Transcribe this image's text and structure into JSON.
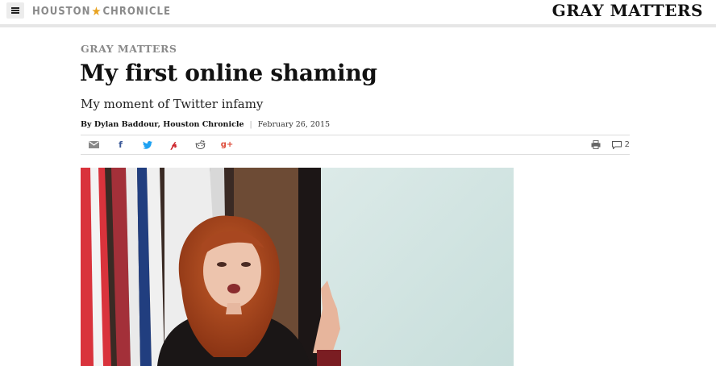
{
  "header": {
    "menu_icon": "hamburger-menu-icon",
    "brand_left": "HOUSTON",
    "brand_right": "CHRONICLE",
    "brand_star_icon": "star-icon",
    "section_brand": "GRAY MATTERS"
  },
  "article": {
    "kicker": "GRAY MATTERS",
    "headline": "My first online shaming",
    "dek": "My moment of Twitter infamy",
    "byline": "By Dylan Baddour, Houston Chronicle",
    "separator": "|",
    "date": "February 26, 2015"
  },
  "share": {
    "icons": [
      "email-icon",
      "facebook-icon",
      "twitter-icon",
      "pinterest-icon",
      "reddit-icon",
      "google-plus-icon"
    ],
    "print_icon": "print-icon",
    "comment_icon": "comment-icon",
    "comment_count": "2"
  },
  "colors": {
    "brand_star": "#e8a21f",
    "facebook": "#3b5998",
    "twitter": "#1da1f2",
    "pinterest": "#cb2027",
    "google_plus": "#dd4b39"
  }
}
